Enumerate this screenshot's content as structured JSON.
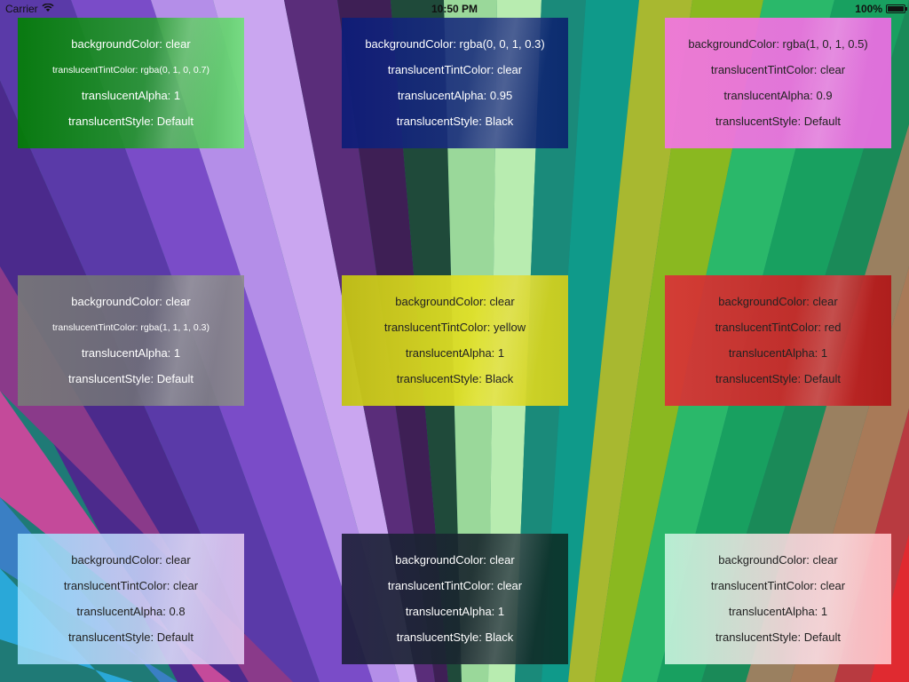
{
  "status_bar": {
    "carrier": "Carrier",
    "time": "10:50 PM",
    "battery": "100%",
    "icons": [
      "wifi-icon",
      "battery-icon"
    ]
  },
  "panels": [
    {
      "lines": [
        "backgroundColor: clear",
        "translucentTintColor: rgba(0, 1, 0, 0.7)",
        "translucentAlpha: 1",
        "translucentStyle: Default"
      ],
      "tint": "#0a8a0a"
    },
    {
      "lines": [
        "backgroundColor: rgba(0, 0, 1, 0.3)",
        "translucentTintColor: clear",
        "translucentAlpha: 0.95",
        "translucentStyle: Black"
      ],
      "tint": "#0c1c78"
    },
    {
      "lines": [
        "backgroundColor: rgba(1, 0, 1, 0.5)",
        "translucentTintColor: clear",
        "translucentAlpha: 0.9",
        "translucentStyle: Default"
      ],
      "tint": "#e878dc"
    },
    {
      "lines": [
        "backgroundColor: clear",
        "translucentTintColor: rgba(1, 1, 1, 0.3)",
        "translucentAlpha: 1",
        "translucentStyle: Default"
      ],
      "tint": "#787878"
    },
    {
      "lines": [
        "backgroundColor: clear",
        "translucentTintColor: yellow",
        "translucentAlpha: 1",
        "translucentStyle: Black"
      ],
      "tint": "#d2d21e"
    },
    {
      "lines": [
        "backgroundColor: clear",
        "translucentTintColor: red",
        "translucentAlpha: 1",
        "translucentStyle: Default"
      ],
      "tint": "#d23232"
    },
    {
      "lines": [
        "backgroundColor: clear",
        "translucentTintColor: clear",
        "translucentAlpha: 0.8",
        "translucentStyle: Default"
      ],
      "tint": "#b4d8f8"
    },
    {
      "lines": [
        "backgroundColor: clear",
        "translucentTintColor: clear",
        "translucentAlpha: 1",
        "translucentStyle: Black"
      ],
      "tint": "#1e2e3c"
    },
    {
      "lines": [
        "backgroundColor: clear",
        "translucentTintColor: clear",
        "translucentAlpha: 1",
        "translucentStyle: Default"
      ],
      "tint": "#f0d2d8"
    }
  ]
}
